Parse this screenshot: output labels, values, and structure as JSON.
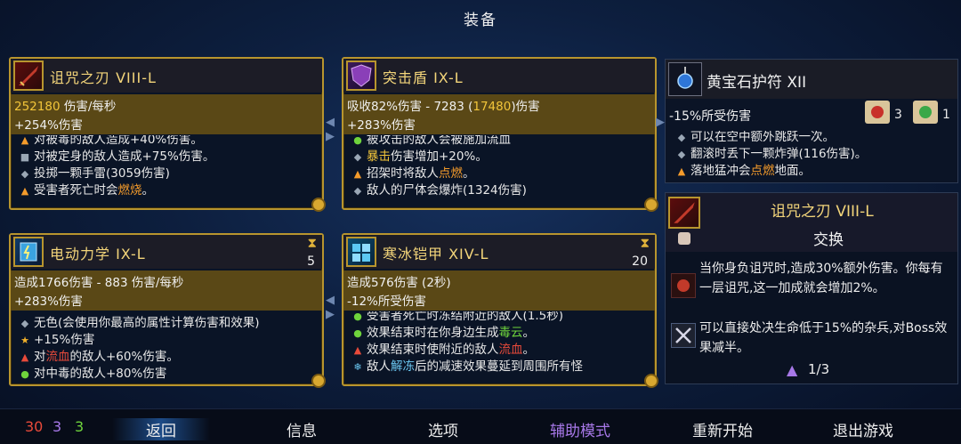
{
  "title": "装备",
  "items": [
    {
      "name": "诅咒之刃 VIII-L",
      "stat1_value": "252180",
      "stat1_rest": " 伤害/每秒",
      "stat2": "+254%伤害",
      "effects": [
        {
          "icon": "flame-icon",
          "pre": "对被毒的敌人造成+40%伤害。",
          "hl": "",
          "post": ""
        },
        {
          "icon": "lock-icon",
          "pre": "对被定身的敌人造成+75%伤害。",
          "hl": "",
          "post": ""
        },
        {
          "icon": "diamond-icon",
          "pre": "投掷一颗手雷(3059伤害)",
          "hl": "",
          "post": ""
        },
        {
          "icon": "flame-icon",
          "pre": "受害者死亡时会",
          "hl": "燃烧",
          "post": "。"
        }
      ]
    },
    {
      "name": "突击盾 IX-L",
      "stat1_pre": "吸收82%伤害 - 7283 (",
      "stat1_hl": "17480",
      "stat1_post": ")伤害",
      "stat2": "+283%伤害",
      "effects": [
        {
          "icon": "poison-icon",
          "pre": "被攻击的敌人会被施加流血",
          "hl": "",
          "post": ""
        },
        {
          "icon": "diamond-icon",
          "pre": "",
          "hl": "暴击",
          "post": "伤害增加+20%。"
        },
        {
          "icon": "flame-icon",
          "pre": "招架时将敌人",
          "hl": "点燃",
          "post": "。"
        },
        {
          "icon": "diamond-icon",
          "pre": "敌人的尸体会爆炸(1324伤害)",
          "hl": "",
          "post": ""
        }
      ]
    },
    {
      "name": "黄宝石护符 XII",
      "stat": "-15%所受伤害",
      "scroll1": "3",
      "scroll2": "1",
      "effects": [
        {
          "icon": "diamond-icon",
          "pre": "可以在空中额外跳跃一次。",
          "hl": "",
          "post": ""
        },
        {
          "icon": "diamond-icon",
          "pre": "翻滚时丢下一颗炸弹(116伤害)。",
          "hl": "",
          "post": ""
        },
        {
          "icon": "flame-icon",
          "pre": "落地猛冲会",
          "hl": "点燃",
          "post": "地面。"
        }
      ]
    },
    {
      "name": "电动力学 IX-L",
      "hourglass": "5",
      "stat1": "造成1766伤害 - 883 伤害/每秒",
      "stat2": "+283%伤害",
      "effects": [
        {
          "icon": "diamond-icon",
          "pre": "无色(会使用你最高的属性计算伤害和效果)",
          "hl": "",
          "post": ""
        },
        {
          "icon": "star-icon",
          "pre": "+15%伤害",
          "hl": "",
          "post": ""
        },
        {
          "icon": "bleed-icon",
          "pre": "对",
          "hl": "流血",
          "post": "的敌人+60%伤害。"
        },
        {
          "icon": "poison-icon",
          "pre": "对中毒的敌人+80%伤害",
          "hl": "",
          "post": ""
        }
      ]
    },
    {
      "name": "寒冰铠甲 XIV-L",
      "hourglass": "20",
      "stat1": "造成576伤害 (2秒)",
      "stat2": "-12%所受伤害",
      "effects": [
        {
          "icon": "poison-icon",
          "pre": "受害者死亡时冻结附近的敌人(1.5秒)",
          "hl": "",
          "post": ""
        },
        {
          "icon": "poison-icon",
          "pre": "效果结束时在你身边生成",
          "hl": "毒云",
          "post": "。"
        },
        {
          "icon": "bleed-icon",
          "pre": "效果结束时使附近的敌人",
          "hl": "流血",
          "post": "。"
        },
        {
          "icon": "freeze-icon",
          "pre": "敌人",
          "hl": "解冻",
          "post": "后的减速效果蔓延到周围所有怪"
        }
      ]
    }
  ],
  "compare": {
    "name": "诅咒之刃 VIII-L",
    "action": "交换",
    "lines": [
      {
        "icon": "curse-icon",
        "text": "当你身负诅咒时,造成30%额外伤害。你每有一层诅咒,这一加成就会增加2%。"
      },
      {
        "icon": "crossed-swords-icon",
        "text": "可以直接处决生命低于15%的杂兵,对Boss效果减半。"
      }
    ],
    "count": "1/3"
  },
  "stats": {
    "red": "30",
    "purple": "3",
    "green": "3"
  },
  "menu": {
    "back": "返回",
    "info": "信息",
    "options": "选项",
    "assist": "辅助模式",
    "restart": "重新开始",
    "quit": "退出游戏"
  },
  "colors": {
    "accent_gold": "#b8952e",
    "stat_band": "#5a4816",
    "assist_purple": "#a778e8",
    "brutality": "#e84a3a",
    "tactics": "#a778e8",
    "survival": "#6fd43c"
  }
}
